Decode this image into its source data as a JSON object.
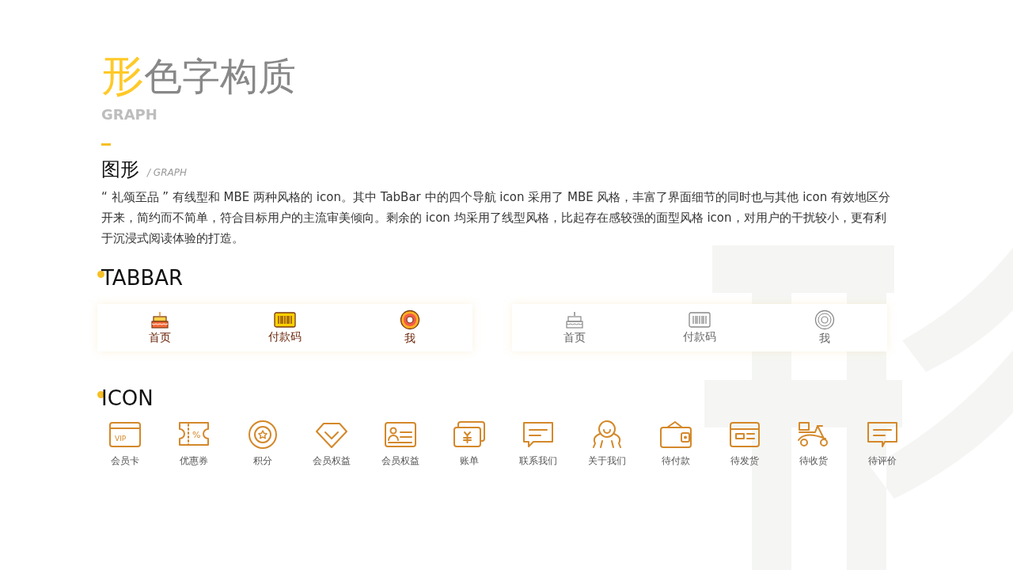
{
  "header": {
    "accent_char": "形",
    "rest": "色字构质",
    "subtitle": "GRAPH"
  },
  "section": {
    "title": "图形",
    "tag": "/ GRAPH",
    "description": "“ 礼颂至品 ” 有线型和 MBE 两种风格的 icon。其中 TabBar 中的四个导航 icon 采用了 MBE 风格，丰富了界面细节的同时也与其他 icon 有效地区分开来，简约而不简单，符合目标用户的主流审美倾向。剩余的 icon 均采用了线型风格，比起存在感较强的面型风格 icon，对用户的干扰较小，更有利于沉浸式阅读体验的打造。"
  },
  "tabbar_heading": "TABBAR",
  "tabbars": [
    {
      "items": [
        {
          "kind": "cake",
          "label": "首页"
        },
        {
          "kind": "barcode",
          "label": "付款码"
        },
        {
          "kind": "donut",
          "label": "我"
        }
      ]
    },
    {
      "items": [
        {
          "kind": "cake",
          "label": "首页"
        },
        {
          "kind": "barcode",
          "label": "付款码"
        },
        {
          "kind": "donut",
          "label": "我"
        }
      ]
    }
  ],
  "icon_heading": "ICON",
  "icons": [
    {
      "kind": "vip",
      "label": "会员卡",
      "mark": "VIP"
    },
    {
      "kind": "ticket",
      "label": "优惠券",
      "mark": "%"
    },
    {
      "kind": "coin",
      "label": "积分"
    },
    {
      "kind": "diamond",
      "label": "会员权益"
    },
    {
      "kind": "idcard",
      "label": "会员权益"
    },
    {
      "kind": "bill",
      "label": "账单"
    },
    {
      "kind": "chat",
      "label": "联系我们"
    },
    {
      "kind": "person",
      "label": "关于我们"
    },
    {
      "kind": "wallet",
      "label": "待付款"
    },
    {
      "kind": "card",
      "label": "待发货"
    },
    {
      "kind": "scooter",
      "label": "待收货"
    },
    {
      "kind": "comment",
      "label": "待评价"
    }
  ]
}
